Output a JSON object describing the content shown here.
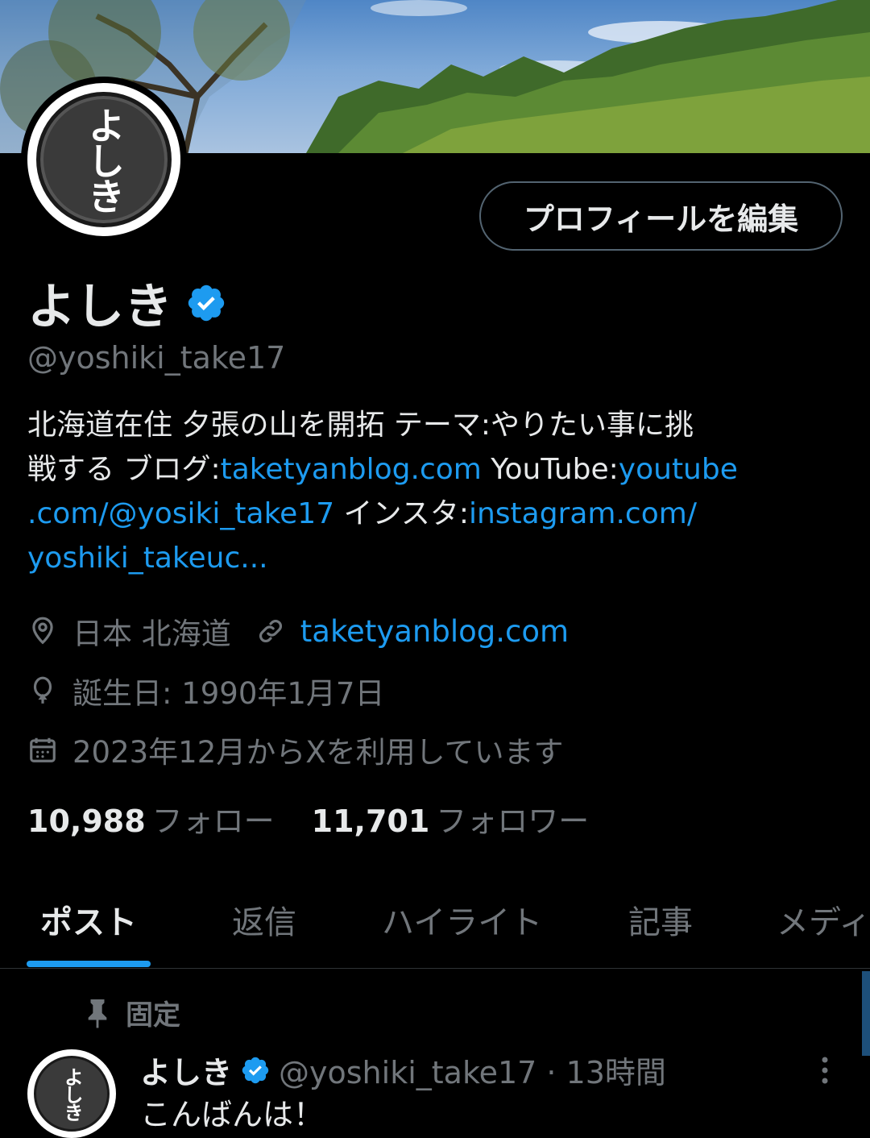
{
  "profile": {
    "display_name": "よしき",
    "handle": "@yoshiki_take17",
    "avatar_text": "よしき",
    "edit_button": "プロフィールを編集"
  },
  "bio": {
    "line1": "北海道在住 夕張の山を開拓 テーマ:やりたい事に挑",
    "line2_a": "戦する ブログ:",
    "line2_link": "taketyanblog.com",
    "line2_b": " YouTube:",
    "line2_link2": "youtube",
    "line3_link": ".com/@yosiki_take17",
    "line3_b": " インスタ:",
    "line3_link2": "instagram.com/",
    "line4_link": "yoshiki_takeuc..."
  },
  "meta": {
    "location": "日本 北海道",
    "website": "taketyanblog.com",
    "birthday": "誕生日: 1990年1月7日",
    "joined": "2023年12月からXを利用しています"
  },
  "follow": {
    "following_count": "10,988",
    "following_label": "フォロー",
    "followers_count": "11,701",
    "followers_label": "フォロワー"
  },
  "tabs": [
    {
      "label": "ポスト"
    },
    {
      "label": "返信"
    },
    {
      "label": "ハイライト"
    },
    {
      "label": "記事"
    },
    {
      "label": "メディ"
    }
  ],
  "pinned_post": {
    "pinned_label": "固定",
    "author_name": "よしき",
    "author_meta": "@yoshiki_take17 · 13時間",
    "text": "こんばんは！"
  },
  "colors": {
    "accent": "#1d9bf0",
    "muted": "#71767b",
    "background": "#000000"
  },
  "icons": [
    "verified-badge-icon",
    "location-pin-icon",
    "link-icon",
    "balloon-icon",
    "calendar-icon",
    "pin-icon",
    "more-dots-icon"
  ]
}
